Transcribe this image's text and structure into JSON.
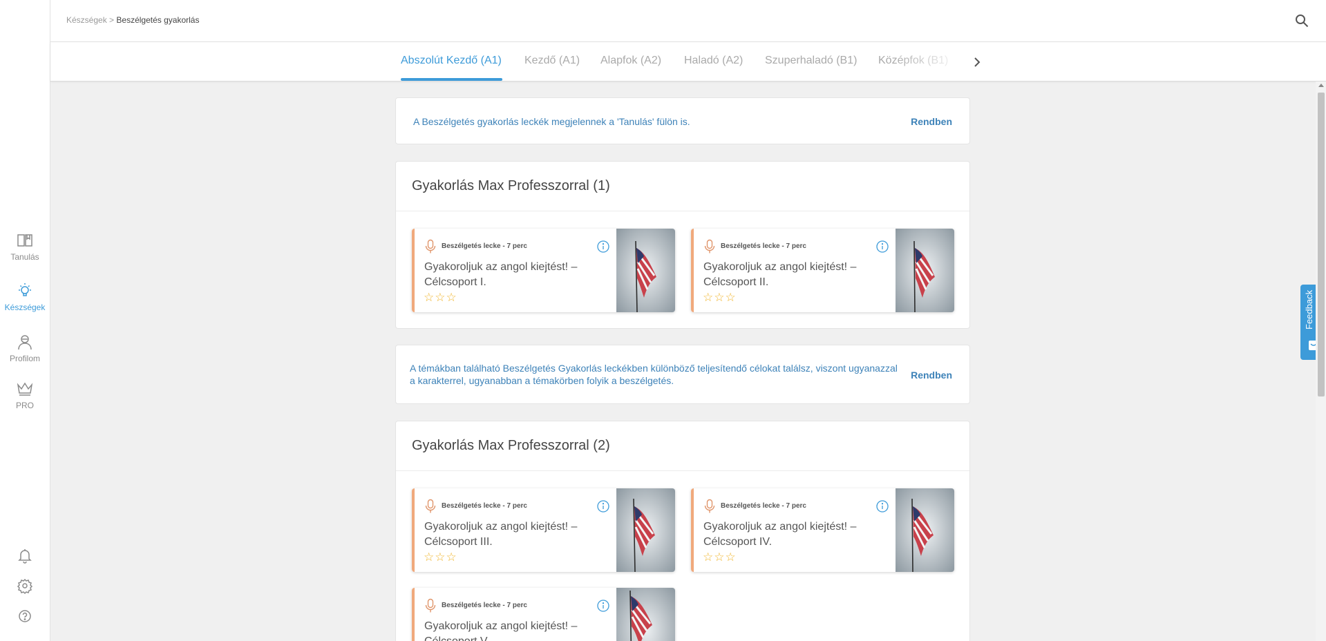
{
  "sidebar": {
    "items": [
      {
        "label": "Tanulás",
        "icon": "book-icon"
      },
      {
        "label": "Készségek",
        "icon": "lightbulb-icon"
      },
      {
        "label": "Profilom",
        "icon": "profile-icon"
      },
      {
        "label": "PRO",
        "icon": "crown-icon"
      }
    ],
    "bottom_icons": [
      "bell-icon",
      "gear-icon",
      "help-icon"
    ]
  },
  "breadcrumb": {
    "parent": "Készségek",
    "separator": " > ",
    "current": "Beszélgetés gyakorlás"
  },
  "tabs": [
    {
      "label": "Abszolút Kezdő (A1)",
      "active": true
    },
    {
      "label": "Kezdő (A1)"
    },
    {
      "label": "Alapfok (A2)"
    },
    {
      "label": "Haladó (A2)"
    },
    {
      "label": "Szuperhaladó (B1)"
    },
    {
      "label": "Középfok (B1)"
    }
  ],
  "notices": [
    {
      "text": "A Beszélgetés gyakorlás leckék megjelennek a 'Tanulás' fülön is.",
      "button": "Rendben"
    },
    {
      "text_line1": "A témákban található Beszélgetés Gyakorlás leckékben különböző teljesítendő célokat találsz, viszont ugyanazzal",
      "text_line2": "a karakterrel, ugyanabban a témakörben folyik a beszélgetés.",
      "button": "Rendben"
    }
  ],
  "sections": [
    {
      "title": "Gyakorlás Max Professzorral (1)",
      "lessons": [
        {
          "meta": "Beszélgetés lecke - 7 perc",
          "title_line1": "Gyakoroljuk az angol kiejtést! –",
          "title_line2": "Célcsoport I.",
          "stars": "☆☆☆"
        },
        {
          "meta": "Beszélgetés lecke - 7 perc",
          "title_line1": "Gyakoroljuk az angol kiejtést! –",
          "title_line2": "Célcsoport II.",
          "stars": "☆☆☆"
        }
      ]
    },
    {
      "title": "Gyakorlás Max Professzorral (2)",
      "lessons": [
        {
          "meta": "Beszélgetés lecke - 7 perc",
          "title_line1": "Gyakoroljuk az angol kiejtést! –",
          "title_line2": "Célcsoport III.",
          "stars": "☆☆☆"
        },
        {
          "meta": "Beszélgetés lecke - 7 perc",
          "title_line1": "Gyakoroljuk az angol kiejtést! –",
          "title_line2": "Célcsoport IV.",
          "stars": "☆☆☆"
        },
        {
          "meta": "Beszélgetés lecke - 7 perc",
          "title_line1": "Gyakoroljuk az angol kiejtést! –",
          "title_line2": "Célcsoport V.",
          "stars": "☆☆☆"
        }
      ]
    }
  ],
  "feedback": {
    "label": "Feedback"
  },
  "colors": {
    "accent": "#3d9bd9",
    "lesson_accent": "#f0a97c",
    "star": "#f0b429",
    "notice_text": "#3d82b8"
  }
}
